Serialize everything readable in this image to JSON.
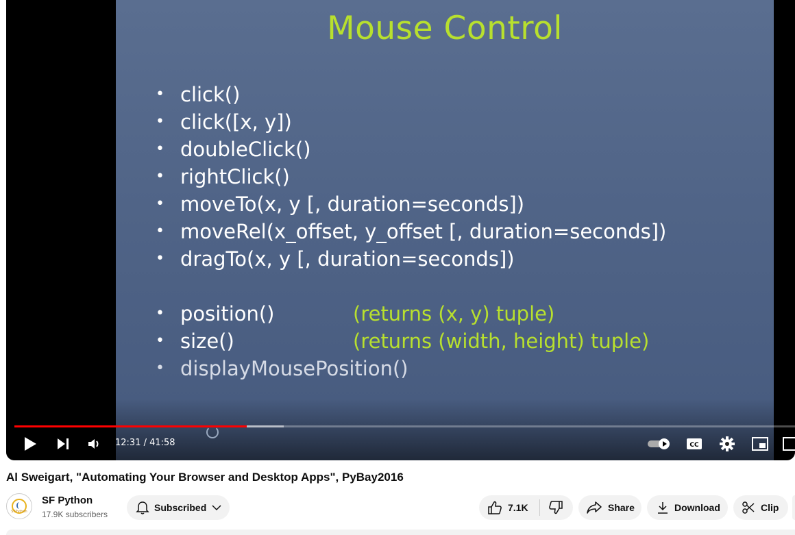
{
  "slide": {
    "title": "Mouse Control",
    "items": [
      "click()",
      "click([x, y])",
      "doubleClick()",
      "rightClick()",
      "moveTo(x, y [, duration=seconds])",
      "moveRel(x_offset, y_offset [, duration=seconds])",
      "dragTo(x, y [, duration=seconds])"
    ],
    "items2": [
      {
        "fn": "position()",
        "note": "(returns (x, y) tuple)"
      },
      {
        "fn": "size()",
        "note": "(returns (width, height) tuple)"
      },
      {
        "fn": "displayMousePosition()",
        "note": ""
      }
    ]
  },
  "player": {
    "time_display": "12:31 / 41:58",
    "progress_fraction": 0.298,
    "buffered_fraction": 0.345,
    "icons": [
      "play-icon",
      "next-icon",
      "volume-icon",
      "autoplay-toggle",
      "captions-icon",
      "settings-icon",
      "miniplayer-icon",
      "theater-icon"
    ],
    "accent": "#ff0000"
  },
  "video": {
    "title": "Al Sweigart, \"Automating Your Browser and Desktop Apps\", PyBay2016"
  },
  "channel": {
    "name": "SF Python",
    "subscribers": "17.9K subscribers",
    "avatar_text": "SFPython"
  },
  "actions": {
    "subscribed_label": "Subscribed",
    "like_count": "7.1K",
    "share_label": "Share",
    "download_label": "Download",
    "clip_label": "Clip"
  }
}
